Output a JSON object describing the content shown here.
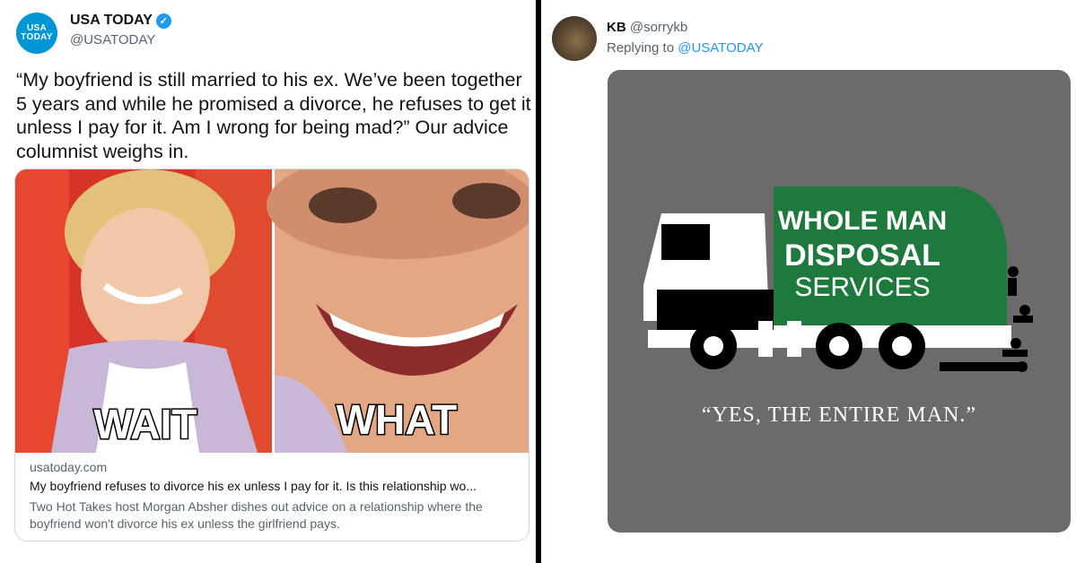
{
  "left_tweet": {
    "avatar": {
      "line1": "USA",
      "line2": "TODAY",
      "color": "#0096d6"
    },
    "name": "USA TODAY",
    "verified_icon": "check",
    "handle": "@USATODAY",
    "text": "“My boyfriend is still married to his ex. We’ve been together 5 years and while he promised a divorce, he refuses to get it unless I pay for it. Am I wrong for being mad?” Our advice columnist weighs in.",
    "card": {
      "meme_left_caption": "WAIT",
      "meme_right_caption": "WHAT",
      "domain": "usatoday.com",
      "title": "My boyfriend refuses to divorce his ex unless I pay for it. Is this relationship wo...",
      "description": "Two Hot Takes host Morgan Absher dishes out advice on a relationship where the boyfriend won't divorce his ex unless the girlfriend pays."
    }
  },
  "right_tweet": {
    "name": "KB",
    "handle": "@sorrykb",
    "reply_prefix": "Replying to",
    "reply_to": "@USATODAY",
    "image": {
      "truck_line1": "WHOLE MAN",
      "truck_line2": "DISPOSAL",
      "truck_line3": "SERVICES",
      "tagline": "“YES, THE ENTIRE MAN.”",
      "truck_green": "#1e7a3c",
      "background": "#6b6b6b"
    }
  }
}
